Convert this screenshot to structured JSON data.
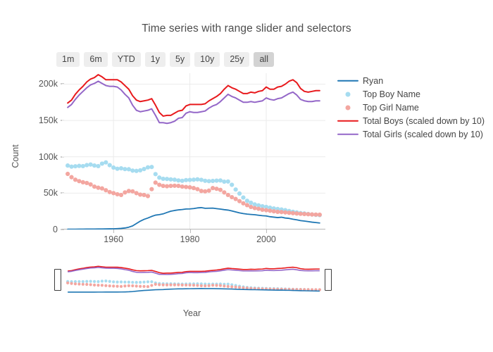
{
  "header": {
    "title": "Time series with range slider and selectors"
  },
  "range_selector": {
    "buttons": [
      {
        "label": "1m",
        "active": false
      },
      {
        "label": "6m",
        "active": false
      },
      {
        "label": "YTD",
        "active": false
      },
      {
        "label": "1y",
        "active": false
      },
      {
        "label": "5y",
        "active": false
      },
      {
        "label": "10y",
        "active": false
      },
      {
        "label": "25y",
        "active": false
      },
      {
        "label": "all",
        "active": true
      }
    ]
  },
  "axes": {
    "x_title": "Year",
    "y_title": "Count",
    "x_ticks": [
      "1960",
      "1980",
      "2000"
    ],
    "x_tick_values": [
      1960,
      1980,
      2000
    ],
    "y_ticks": [
      "0",
      "50k",
      "100k",
      "150k",
      "200k"
    ],
    "y_tick_values": [
      0,
      50000,
      100000,
      150000,
      200000
    ]
  },
  "legend": {
    "position": "right",
    "items": [
      {
        "label": "Ryan",
        "mode": "line",
        "color": "#1f77b4"
      },
      {
        "label": "Top Boy Name",
        "mode": "markers",
        "color": "#a6dcf0"
      },
      {
        "label": "Top Girl Name",
        "mode": "markers",
        "color": "#f3a6a0"
      },
      {
        "label": "Total Boys (scaled down by 10)",
        "mode": "line",
        "color": "#e8191c"
      },
      {
        "label": "Total Girls (scaled down by 10)",
        "mode": "line",
        "color": "#9467c8"
      }
    ]
  },
  "rangeslider": {
    "left_handle": "range-slider-left-handle",
    "right_handle": "range-slider-right-handle",
    "visible_range": [
      1948,
      2014
    ]
  },
  "chart_data": {
    "type": "line",
    "title": "Time series with range slider and selectors",
    "xlabel": "Year",
    "ylabel": "Count",
    "xlim": [
      1946.5,
      2015.5
    ],
    "ylim": [
      0,
      215000
    ],
    "grid": true,
    "legend_position": "right",
    "x": [
      1948,
      1949,
      1950,
      1951,
      1952,
      1953,
      1954,
      1955,
      1956,
      1957,
      1958,
      1959,
      1960,
      1961,
      1962,
      1963,
      1964,
      1965,
      1966,
      1967,
      1968,
      1969,
      1970,
      1971,
      1972,
      1973,
      1974,
      1975,
      1976,
      1977,
      1978,
      1979,
      1980,
      1981,
      1982,
      1983,
      1984,
      1985,
      1986,
      1987,
      1988,
      1989,
      1990,
      1991,
      1992,
      1993,
      1994,
      1995,
      1996,
      1997,
      1998,
      1999,
      2000,
      2001,
      2002,
      2003,
      2004,
      2005,
      2006,
      2007,
      2008,
      2009,
      2010,
      2011,
      2012,
      2013,
      2014
    ],
    "series": [
      {
        "name": "Ryan",
        "mode": "line",
        "color": "#1f77b4",
        "values": [
          300,
          330,
          380,
          420,
          470,
          520,
          560,
          620,
          680,
          740,
          820,
          900,
          1000,
          1200,
          1500,
          2100,
          3200,
          5000,
          8200,
          11500,
          14000,
          15800,
          18000,
          19800,
          20500,
          21500,
          23400,
          25200,
          26200,
          27000,
          27500,
          28200,
          28300,
          28800,
          29700,
          30100,
          29200,
          29300,
          29400,
          28700,
          28100,
          27300,
          26700,
          25600,
          24200,
          22900,
          21900,
          21200,
          20700,
          20300,
          19600,
          19000,
          18600,
          17600,
          17000,
          16400,
          16900,
          15800,
          15300,
          14200,
          13300,
          12200,
          11600,
          10900,
          10100,
          9600,
          9000
        ]
      },
      {
        "name": "Top Boy Name",
        "mode": "markers",
        "color": "#a6dcf0",
        "values": [
          88000,
          86500,
          87000,
          87500,
          87200,
          88600,
          89400,
          88000,
          87200,
          90600,
          92300,
          88500,
          85200,
          83600,
          84200,
          83100,
          82900,
          81000,
          80600,
          81400,
          83200,
          85500,
          86000,
          76200,
          71400,
          69800,
          69500,
          68900,
          68500,
          67500,
          67000,
          68000,
          68200,
          68500,
          69000,
          68300,
          67000,
          66500,
          66800,
          67200,
          67500,
          65800,
          66000,
          61500,
          55000,
          49500,
          44000,
          39500,
          36800,
          34500,
          33200,
          32000,
          31000,
          30000,
          29000,
          28200,
          27500,
          26600,
          25400,
          24400,
          23500,
          22500,
          22000,
          21300,
          20700,
          20200,
          19800
        ]
      },
      {
        "name": "Top Girl Name",
        "mode": "markers",
        "color": "#f3a6a0",
        "values": [
          76500,
          72000,
          68500,
          66500,
          65000,
          64000,
          62000,
          59000,
          57500,
          56500,
          54000,
          51500,
          50000,
          48500,
          47500,
          51000,
          53000,
          52500,
          50000,
          48000,
          47500,
          46000,
          55500,
          64500,
          61500,
          60000,
          59500,
          60000,
          60200,
          60000,
          59000,
          58500,
          58000,
          57000,
          55500,
          53000,
          52500,
          53500,
          57000,
          56000,
          54500,
          51000,
          47500,
          44500,
          42000,
          39000,
          36000,
          33500,
          31000,
          29500,
          28500,
          27200,
          26600,
          25800,
          25000,
          24300,
          24000,
          23500,
          23000,
          22500,
          22000,
          21600,
          21300,
          21000,
          20700,
          20500,
          20400
        ]
      },
      {
        "name": "Total Boys (scaled down by 10)",
        "mode": "line",
        "color": "#e8191c",
        "values": [
          174000,
          178000,
          186000,
          192000,
          197000,
          203000,
          207000,
          209000,
          213000,
          210000,
          206000,
          206000,
          206000,
          206000,
          203000,
          198000,
          193000,
          184000,
          178000,
          176000,
          177000,
          178000,
          180000,
          171000,
          161000,
          156000,
          157000,
          157000,
          160000,
          163000,
          164000,
          170000,
          172000,
          172000,
          172000,
          172000,
          173000,
          177000,
          180000,
          183000,
          187000,
          193000,
          198000,
          195000,
          193000,
          190000,
          187000,
          187000,
          189000,
          188000,
          190000,
          191000,
          196000,
          193000,
          193000,
          196000,
          197000,
          200000,
          204000,
          206000,
          202000,
          194000,
          190000,
          189000,
          190000,
          191000,
          191000
        ]
      },
      {
        "name": "Total Girls (scaled down by 10)",
        "mode": "line",
        "color": "#9467c8",
        "values": [
          168000,
          172000,
          179000,
          185000,
          190000,
          195000,
          199000,
          201000,
          204000,
          201000,
          198000,
          197000,
          197000,
          196000,
          192000,
          186000,
          181000,
          171000,
          164000,
          162000,
          163000,
          164000,
          166000,
          157000,
          147000,
          147000,
          146000,
          147000,
          149000,
          153000,
          154000,
          160000,
          162000,
          161000,
          161000,
          162000,
          163000,
          167000,
          170000,
          172000,
          176000,
          181000,
          186000,
          183000,
          181000,
          178000,
          175000,
          175000,
          176000,
          175000,
          176000,
          177000,
          181000,
          179000,
          178000,
          180000,
          181000,
          184000,
          187000,
          189000,
          185000,
          179000,
          177000,
          176000,
          176000,
          177000,
          177000
        ]
      }
    ]
  }
}
